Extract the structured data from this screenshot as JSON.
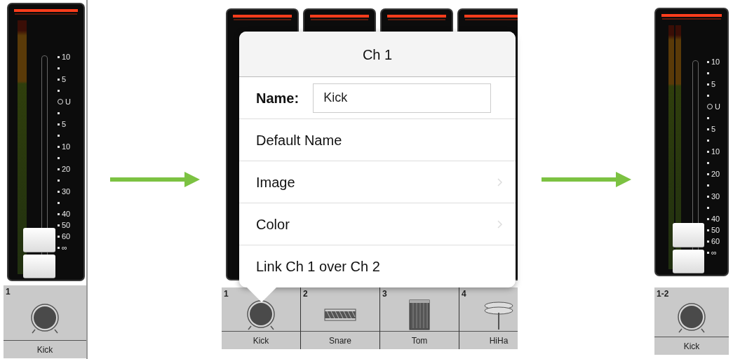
{
  "before": {
    "fader": {
      "linked": false,
      "scale": [
        {
          "label": "10",
          "kind": "mark"
        },
        {
          "label": "5",
          "kind": "mark"
        },
        {
          "label": "U",
          "kind": "unity"
        },
        {
          "label": "5",
          "kind": "mark"
        },
        {
          "label": "10",
          "kind": "mark"
        },
        {
          "label": "20",
          "kind": "mark"
        },
        {
          "label": "30",
          "kind": "mark"
        },
        {
          "label": "40",
          "kind": "mark"
        },
        {
          "label": "50",
          "kind": "mark"
        },
        {
          "label": "60",
          "kind": "mark"
        },
        {
          "label": "∞",
          "kind": "mark"
        }
      ]
    },
    "channel": {
      "number": "1",
      "name": "Kick",
      "kind": "kick"
    }
  },
  "during": {
    "channels": [
      {
        "number": "1",
        "name": "Kick",
        "kind": "kick",
        "selected": true
      },
      {
        "number": "2",
        "name": "Snare",
        "kind": "snare",
        "selected": false
      },
      {
        "number": "3",
        "name": "Tom",
        "kind": "tom",
        "selected": false
      },
      {
        "number": "4",
        "name": "HiHa",
        "kind": "hihat",
        "selected": false
      }
    ],
    "popover": {
      "title": "Ch 1",
      "name_label": "Name:",
      "name_value": "Kick",
      "items": [
        {
          "label": "Default Name",
          "kind": "action"
        },
        {
          "label": "Image",
          "kind": "submenu"
        },
        {
          "label": "Color",
          "kind": "submenu"
        },
        {
          "label": "Link Ch 1 over Ch 2",
          "kind": "action"
        }
      ]
    }
  },
  "after": {
    "fader": {
      "linked": true,
      "scale": [
        {
          "label": "10",
          "kind": "mark"
        },
        {
          "label": "5",
          "kind": "mark"
        },
        {
          "label": "U",
          "kind": "unity"
        },
        {
          "label": "5",
          "kind": "mark"
        },
        {
          "label": "10",
          "kind": "mark"
        },
        {
          "label": "20",
          "kind": "mark"
        },
        {
          "label": "30",
          "kind": "mark"
        },
        {
          "label": "40",
          "kind": "mark"
        },
        {
          "label": "50",
          "kind": "mark"
        },
        {
          "label": "60",
          "kind": "mark"
        },
        {
          "label": "∞",
          "kind": "mark"
        }
      ]
    },
    "channel": {
      "number": "1-2",
      "name": "Kick",
      "kind": "kick"
    }
  }
}
